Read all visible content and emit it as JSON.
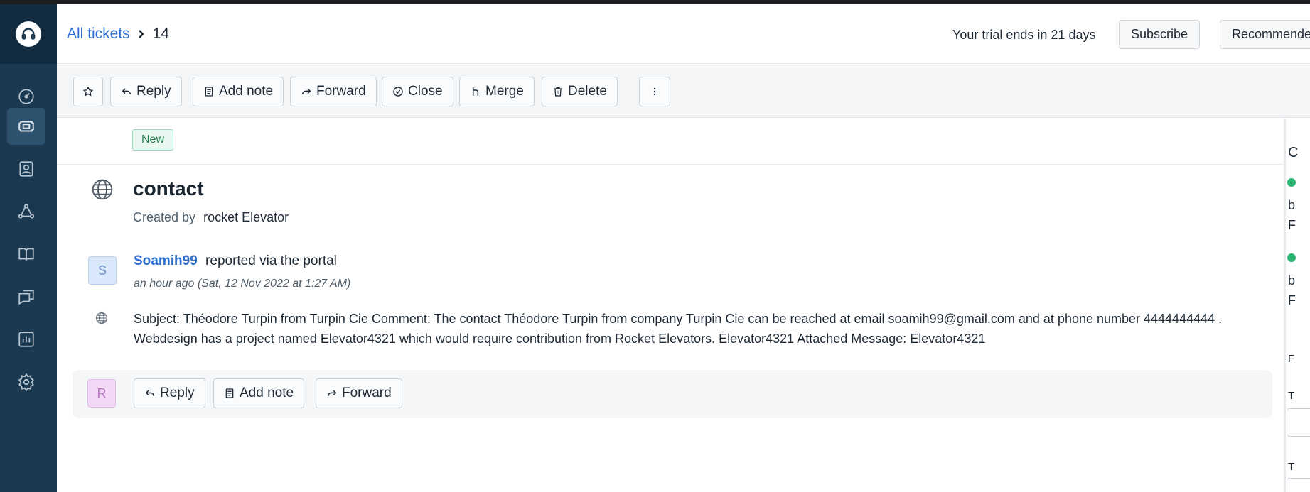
{
  "breadcrumb": {
    "all_tickets": "All tickets",
    "current": "14"
  },
  "header": {
    "trial_text": "Your trial ends in 21 days",
    "subscribe_label": "Subscribe",
    "recommended_label": "Recommende"
  },
  "toolbar": {
    "star_icon": "star-icon",
    "reply_label": "Reply",
    "add_note_label": "Add note",
    "forward_label": "Forward",
    "close_label": "Close",
    "merge_label": "Merge",
    "delete_label": "Delete",
    "more_icon": "more-vertical-icon"
  },
  "sidebar": {
    "items": [
      {
        "icon": "dashboard-icon"
      },
      {
        "icon": "ticket-icon",
        "active": true
      },
      {
        "icon": "contacts-icon"
      },
      {
        "icon": "groups-icon"
      },
      {
        "icon": "knowledge-base-icon"
      },
      {
        "icon": "conversations-icon"
      },
      {
        "icon": "reports-icon"
      },
      {
        "icon": "settings-icon"
      }
    ]
  },
  "ticket": {
    "status": "New",
    "subject": "contact",
    "created_by_label": "Created by",
    "created_by_name": "rocket Elevator",
    "reporter_initial": "S",
    "reporter_name": "Soamih99",
    "reported_via": "reported via the portal",
    "timestamp": "an hour ago (Sat, 12 Nov 2022 at 1:27 AM)",
    "message": "Subject: Théodore Turpin from Turpin Cie Comment: The contact Théodore Turpin from company Turpin Cie can be reached at email soamih99@gmail.com and at phone number 4444444444 . Webdesign has a project named Elevator4321 which would require contribution from Rocket Elevators. Elevator4321 Attached Message: Elevator4321"
  },
  "reply_bar": {
    "avatar_initial": "R",
    "reply_label": "Reply",
    "add_note_label": "Add note",
    "forward_label": "Forward"
  },
  "right_panel": {
    "fragments": [
      "C",
      "b",
      "F",
      "b",
      "F",
      "F",
      "T",
      "T"
    ]
  },
  "colors": {
    "sidebar": "#1b3a51",
    "accent_link": "#2c6fcf",
    "status_green": "#237a4e"
  }
}
